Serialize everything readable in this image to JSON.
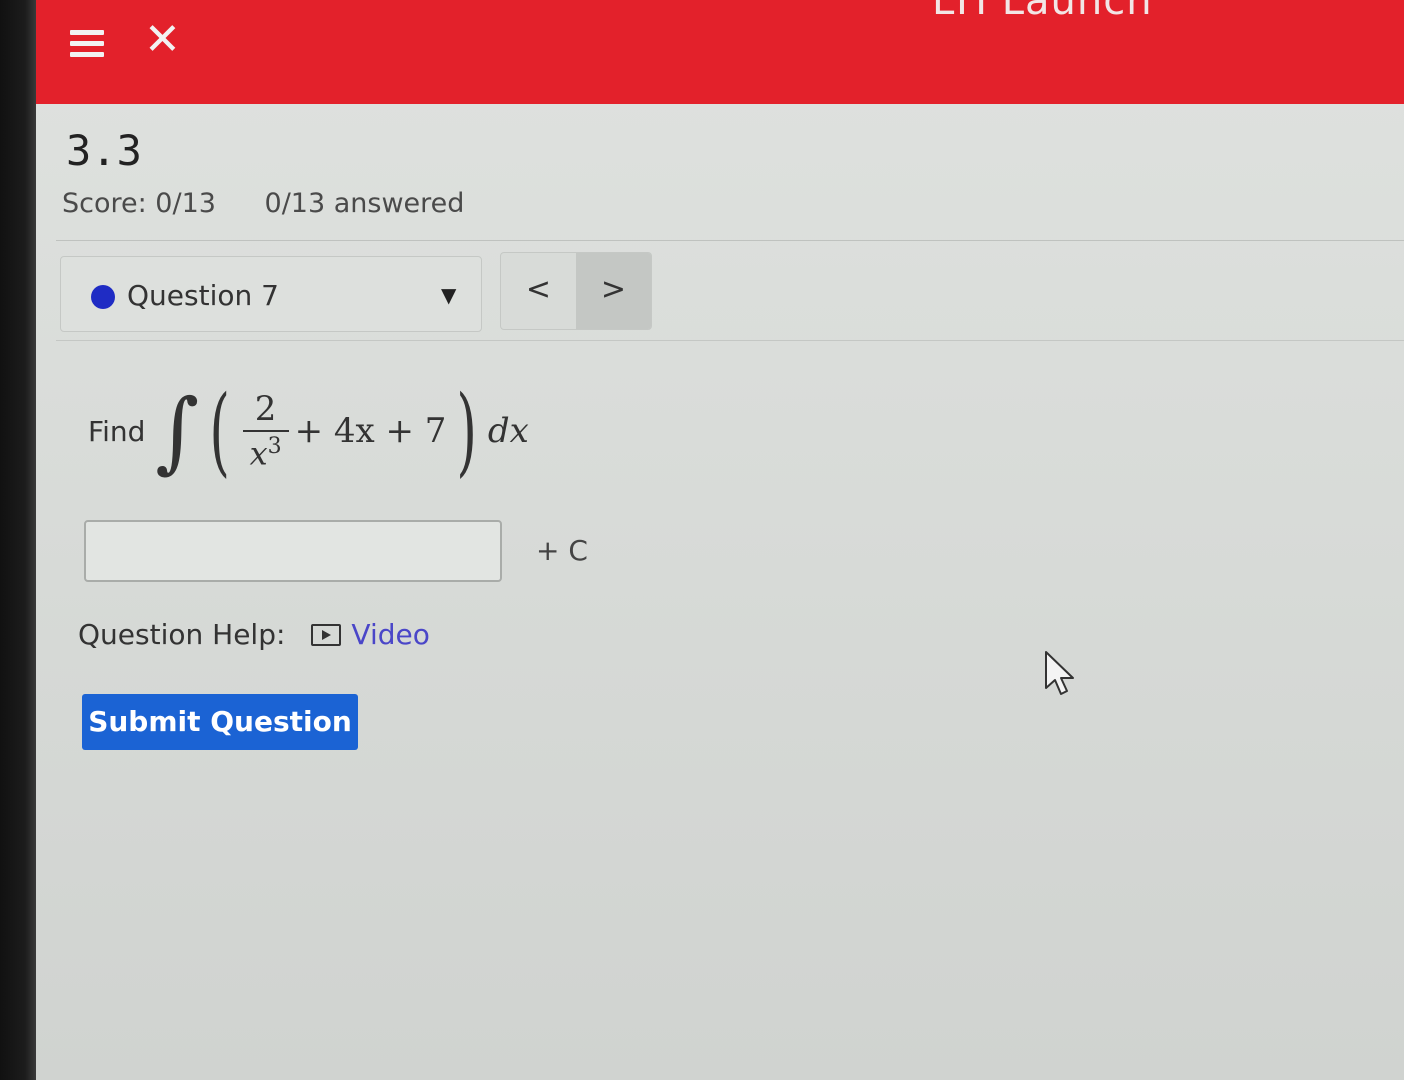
{
  "header": {
    "title": "LTI Launch",
    "bar_color": "#e3212b"
  },
  "assignment": {
    "title": "3.3",
    "score": "Score: 0/13",
    "answered": "0/13 answered"
  },
  "question_nav": {
    "selected": "Question 7",
    "status_dot_color": "#1f2cc4",
    "prev_symbol": "<",
    "next_symbol": ">"
  },
  "question": {
    "prompt": "Find",
    "integral_sign": "∫",
    "open_paren": "(",
    "close_paren": ")",
    "fraction_numerator": "2",
    "fraction_denominator_base": "x",
    "fraction_denominator_exp": "3",
    "middle_terms": "+ 4x + 7",
    "differential": "dx"
  },
  "answer": {
    "value": "",
    "constant": "+ C"
  },
  "help": {
    "label": "Question Help:",
    "video_label": "Video",
    "icon": "video-icon"
  },
  "submit": {
    "label": "Submit Question",
    "color": "#1b63d4"
  }
}
